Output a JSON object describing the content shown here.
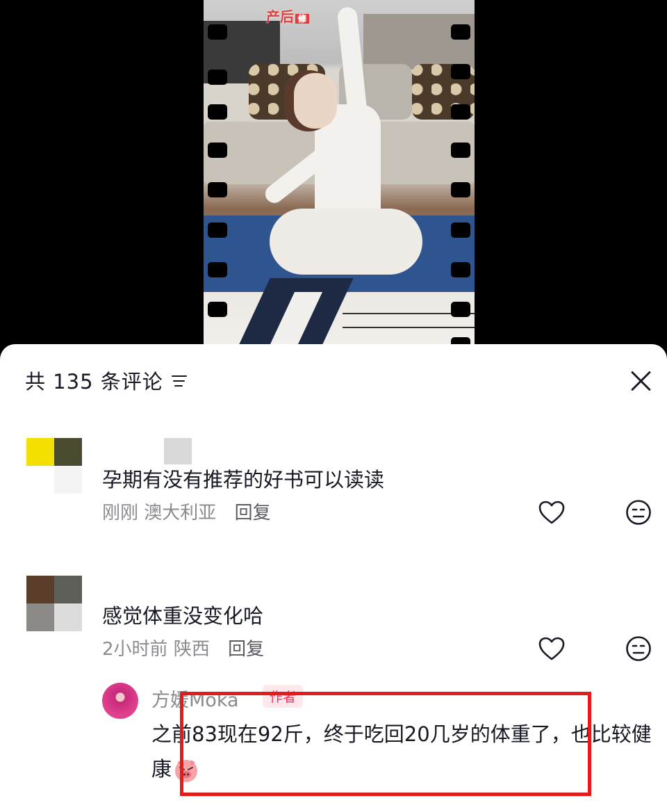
{
  "video": {
    "overlay_text": "产后",
    "overlay_tag": "修"
  },
  "comments_header": {
    "count_label": "共 135 条评论",
    "sort_icon": "filter-lines-icon",
    "close_icon": "close-icon"
  },
  "comments": [
    {
      "text": "孕期有没有推荐的好书可以读读",
      "time": "刚刚",
      "location": "澳大利亚",
      "reply_label": "回复",
      "like_icon": "heart-outline-icon",
      "dislike_icon": "meh-face-icon"
    },
    {
      "text": "感觉体重没变化哈",
      "time": "2小时前",
      "location": "陕西",
      "reply_label": "回复",
      "like_icon": "heart-outline-icon",
      "dislike_icon": "meh-face-icon"
    }
  ],
  "author_reply": {
    "username": "方媛Moka",
    "badge": "作者",
    "text": "之前83现在92斤，终于吃回20几岁的体重了，也比较健康",
    "emoji_icon": "pig-face-emoji-icon"
  },
  "colors": {
    "highlight_border": "#e31b1b",
    "author_badge": "#fe2c55",
    "meta_text": "#8a8b91",
    "primary_text": "#161823"
  }
}
